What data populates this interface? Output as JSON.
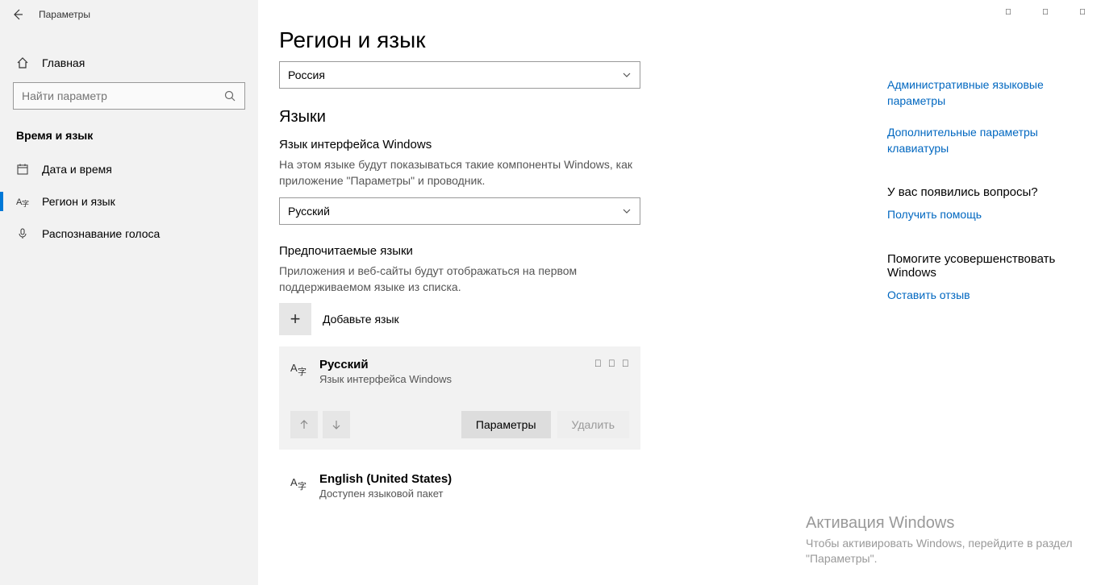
{
  "titlebar": {
    "title": "Параметры"
  },
  "sidebar": {
    "home": "Главная",
    "search_placeholder": "Найти параметр",
    "section": "Время и язык",
    "items": [
      {
        "label": "Дата и время"
      },
      {
        "label": "Регион и язык"
      },
      {
        "label": "Распознавание голоса"
      }
    ]
  },
  "main": {
    "page_title": "Регион и язык",
    "region_value": "Россия",
    "languages_heading": "Языки",
    "interface_lang_label": "Язык интерфейса Windows",
    "interface_lang_desc": "На этом языке будут показываться такие компоненты Windows, как приложение \"Параметры\" и проводник.",
    "interface_lang_value": "Русский",
    "preferred_heading": "Предпочитаемые языки",
    "preferred_desc": "Приложения и веб-сайты будут отображаться на первом поддерживаемом языке из списка.",
    "add_language": "Добавьте язык",
    "installed": [
      {
        "name": "Русский",
        "sub": "Язык интерфейса Windows"
      },
      {
        "name": "English (United States)",
        "sub": "Доступен языковой пакет"
      }
    ],
    "options_btn": "Параметры",
    "remove_btn": "Удалить"
  },
  "rightcol": {
    "link1": "Административные языковые параметры",
    "link2": "Дополнительные параметры клавиатуры",
    "questions_heading": "У вас появились вопросы?",
    "get_help": "Получить помощь",
    "improve_heading": "Помогите усовершенствовать Windows",
    "feedback": "Оставить отзыв"
  },
  "activation": {
    "heading": "Активация Windows",
    "sub": "Чтобы активировать Windows, перейдите в раздел \"Параметры\"."
  }
}
